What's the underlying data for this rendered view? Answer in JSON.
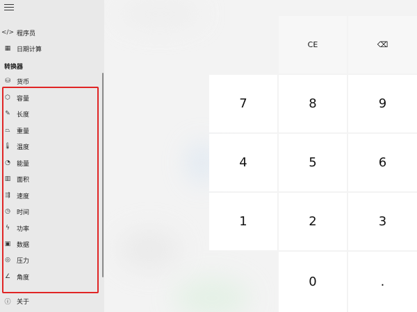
{
  "sidebar": {
    "items_top": [
      {
        "label": "程序员",
        "icon": "code-icon",
        "glyph": "</>"
      },
      {
        "label": "日期计算",
        "icon": "calendar-icon",
        "glyph": "▦"
      }
    ],
    "converter_header": "转换器",
    "converter_items": [
      {
        "label": "货币",
        "icon": "currency-icon",
        "glyph": "⛁"
      },
      {
        "label": "容量",
        "icon": "volume-icon",
        "glyph": "⬡"
      },
      {
        "label": "长度",
        "icon": "ruler-icon",
        "glyph": "✎"
      },
      {
        "label": "重量",
        "icon": "weight-icon",
        "glyph": "⏢"
      },
      {
        "label": "温度",
        "icon": "thermometer-icon",
        "glyph": "🌡"
      },
      {
        "label": "能量",
        "icon": "energy-icon",
        "glyph": "◔"
      },
      {
        "label": "面积",
        "icon": "area-icon",
        "glyph": "▥"
      },
      {
        "label": "速度",
        "icon": "speed-icon",
        "glyph": "⇶"
      },
      {
        "label": "时间",
        "icon": "clock-icon",
        "glyph": "◷"
      },
      {
        "label": "功率",
        "icon": "power-icon",
        "glyph": "ϟ"
      },
      {
        "label": "数据",
        "icon": "data-icon",
        "glyph": "▣"
      },
      {
        "label": "压力",
        "icon": "pressure-icon",
        "glyph": "◎"
      },
      {
        "label": "角度",
        "icon": "angle-icon",
        "glyph": "∠"
      }
    ],
    "about": {
      "label": "关于",
      "icon": "info-icon",
      "glyph": "ⓘ"
    }
  },
  "keypad": {
    "ce": "CE",
    "backspace_glyph": "⌫",
    "digits": [
      "7",
      "8",
      "9",
      "4",
      "5",
      "6",
      "1",
      "2",
      "3"
    ],
    "zero": "0",
    "decimal": "."
  },
  "colors": {
    "highlight": "#e02424",
    "sidebar_bg": "#e9e9e9",
    "key_bg": "#ffffff"
  }
}
